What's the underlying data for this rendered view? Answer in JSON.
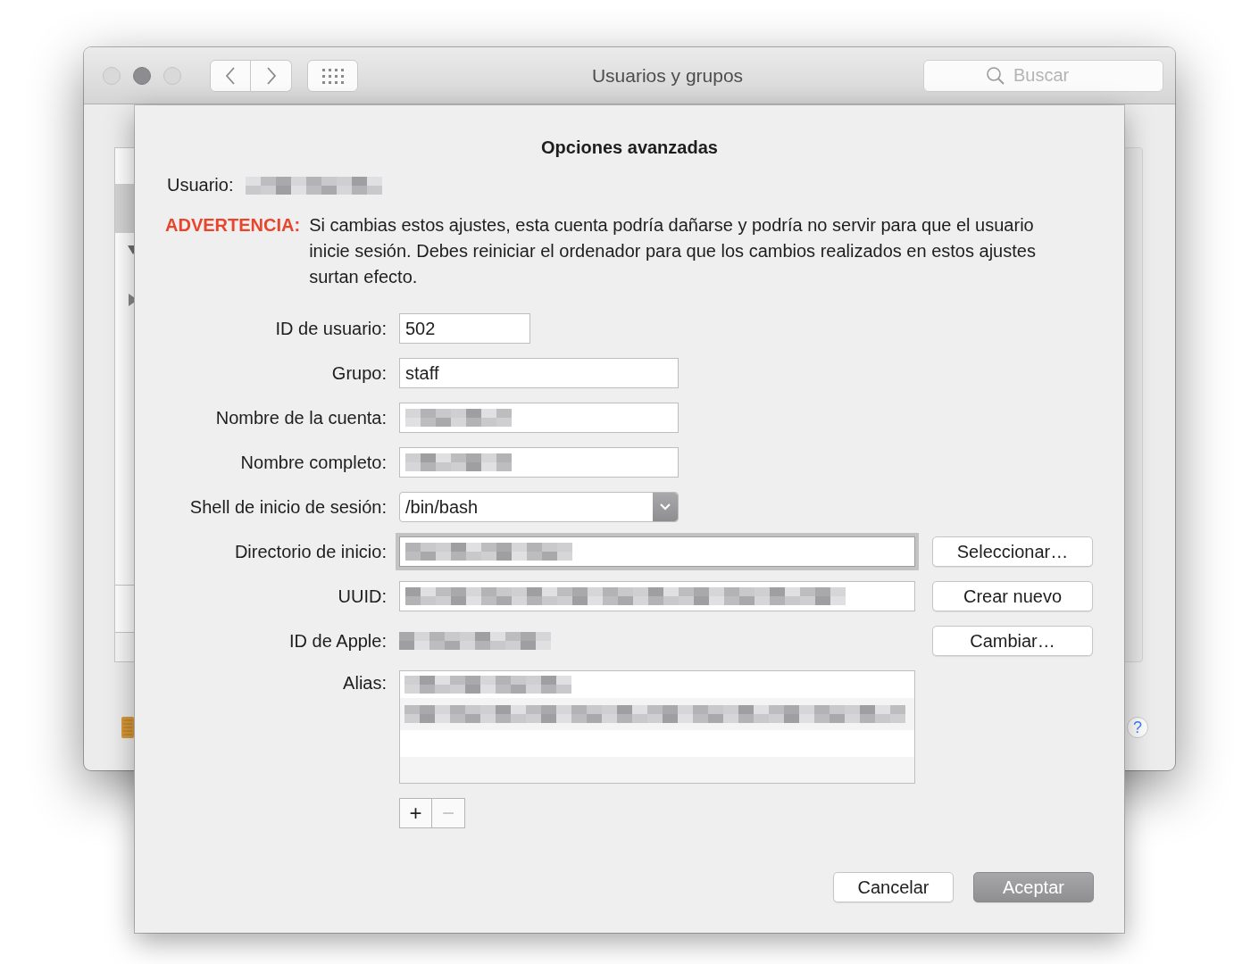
{
  "window": {
    "title": "Usuarios y grupos",
    "search": {
      "placeholder": "Buscar"
    }
  },
  "sidebar": {
    "rows": [
      {
        "kind": "item",
        "selected": true
      },
      {
        "kind": "group",
        "expanded": true
      },
      {
        "kind": "item",
        "selected": false
      },
      {
        "kind": "group",
        "expanded": false
      }
    ]
  },
  "help": "?",
  "dialog": {
    "title": "Opciones avanzadas",
    "user": {
      "label": "Usuario:",
      "redacted": true
    },
    "warning": {
      "label": "ADVERTENCIA:",
      "text": "Si cambias estos ajustes, esta cuenta podría dañarse y podría no servir para que el usuario inicie sesión. Debes reiniciar el ordenador para que los cambios realizados en estos ajustes surtan efecto."
    },
    "fields": [
      {
        "kind": "text",
        "label": "ID de usuario:",
        "value": "502"
      },
      {
        "kind": "text",
        "label": "Grupo:",
        "value": "staff"
      },
      {
        "kind": "text",
        "label": "Nombre de la cuenta:",
        "redacted": true
      },
      {
        "kind": "text",
        "label": "Nombre completo:",
        "redacted": true
      },
      {
        "kind": "popup",
        "label": "Shell de inicio de sesión:",
        "value": "/bin/bash"
      },
      {
        "kind": "text",
        "label": "Directorio de inicio:",
        "redacted": true,
        "focused": true,
        "button": "Seleccionar…"
      },
      {
        "kind": "text",
        "label": "UUID:",
        "redacted": true,
        "button": "Crear nuevo"
      },
      {
        "kind": "static",
        "label": "ID de Apple:",
        "redacted": true,
        "button": "Cambiar…"
      },
      {
        "kind": "list",
        "label": "Alias:",
        "items": [
          {
            "redacted": true
          },
          {
            "redacted": true
          }
        ]
      }
    ],
    "list_buttons": [
      {
        "label": "+",
        "disabled": false
      },
      {
        "label": "−",
        "disabled": true
      }
    ],
    "buttons": [
      {
        "label": "Cancelar",
        "default": false
      },
      {
        "label": "Aceptar",
        "default": true
      }
    ]
  }
}
